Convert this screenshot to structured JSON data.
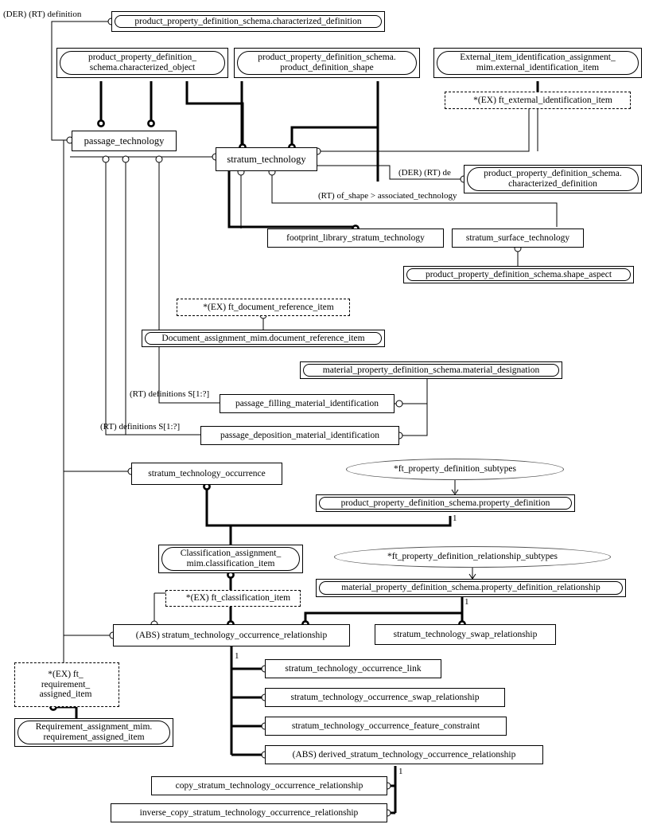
{
  "diagram": {
    "title": "EXPRESS-G entity level diagram",
    "nodes": [
      {
        "id": "n1",
        "label": "product_property_definition_schema.characterized_definition",
        "kind": "capsule"
      },
      {
        "id": "n2",
        "label": "product_property_definition_\nschema.characterized_object",
        "kind": "capsule"
      },
      {
        "id": "n3",
        "label": "product_property_definition_schema.\nproduct_definition_shape",
        "kind": "capsule"
      },
      {
        "id": "n4",
        "label": "External_item_identification_assignment_\nmim.external_identification_item",
        "kind": "capsule"
      },
      {
        "id": "n5",
        "label": "*(EX) ft_external_identification_item",
        "kind": "dashed"
      },
      {
        "id": "n6",
        "label": "passage_technology",
        "kind": "plain"
      },
      {
        "id": "n7",
        "label": "stratum_technology",
        "kind": "plain"
      },
      {
        "id": "n8",
        "label": "product_property_definition_schema.\ncharacterized_definition",
        "kind": "capsule"
      },
      {
        "id": "n9",
        "label": "footprint_library_stratum_technology",
        "kind": "plain"
      },
      {
        "id": "n10",
        "label": "stratum_surface_technology",
        "kind": "plain"
      },
      {
        "id": "n11",
        "label": "product_property_definition_schema.shape_aspect",
        "kind": "capsule"
      },
      {
        "id": "n12",
        "label": "*(EX) ft_document_reference_item",
        "kind": "dashed"
      },
      {
        "id": "n13",
        "label": "Document_assignment_mim.document_reference_item",
        "kind": "capsule"
      },
      {
        "id": "n14",
        "label": "material_property_definition_schema.material_designation",
        "kind": "capsule"
      },
      {
        "id": "n15",
        "label": "passage_filling_material_identification",
        "kind": "plain"
      },
      {
        "id": "n16",
        "label": "passage_deposition_material_identification",
        "kind": "plain"
      },
      {
        "id": "n17",
        "label": "stratum_technology_occurrence",
        "kind": "plain"
      },
      {
        "id": "n18",
        "label": "*ft_property_definition_subtypes",
        "kind": "ellipse"
      },
      {
        "id": "n19",
        "label": "product_property_definition_schema.property_definition",
        "kind": "capsule"
      },
      {
        "id": "n20",
        "label": "Classification_assignment_\nmim.classification_item",
        "kind": "capsule"
      },
      {
        "id": "n21",
        "label": "*ft_property_definition_relationship_subtypes",
        "kind": "ellipse"
      },
      {
        "id": "n22",
        "label": "material_property_definition_schema.property_definition_relationship",
        "kind": "capsule"
      },
      {
        "id": "n23",
        "label": "*(EX) ft_classification_item",
        "kind": "dashed"
      },
      {
        "id": "n24",
        "label": "(ABS) stratum_technology_occurrence_relationship",
        "kind": "plain"
      },
      {
        "id": "n25",
        "label": "stratum_technology_swap_relationship",
        "kind": "plain"
      },
      {
        "id": "n26",
        "label": "*(EX) ft_\nrequirement_\nassigned_item",
        "kind": "dashed-center"
      },
      {
        "id": "n27",
        "label": "Requirement_assignment_mim.\nrequirement_assigned_item",
        "kind": "capsule"
      },
      {
        "id": "n28",
        "label": "stratum_technology_occurrence_link",
        "kind": "plain"
      },
      {
        "id": "n29",
        "label": "stratum_technology_occurrence_swap_relationship",
        "kind": "plain"
      },
      {
        "id": "n30",
        "label": "stratum_technology_occurrence_feature_constraint",
        "kind": "plain"
      },
      {
        "id": "n31",
        "label": "(ABS) derived_stratum_technology_occurrence_relationship",
        "kind": "plain"
      },
      {
        "id": "n32",
        "label": "copy_stratum_technology_occurrence_relationship",
        "kind": "plain"
      },
      {
        "id": "n33",
        "label": "inverse_copy_stratum_technology_occurrence_relationship",
        "kind": "plain"
      }
    ],
    "edge_labels": [
      {
        "id": "e1",
        "text": "(DER) (RT) definition"
      },
      {
        "id": "e2",
        "text": "(DER) (RT) de"
      },
      {
        "id": "e3",
        "text": "(RT) of_shape > associated_technology"
      },
      {
        "id": "e4",
        "text": "(RT) definitions S[1:?]"
      },
      {
        "id": "e5",
        "text": "(RT) definitions S[1:?]"
      }
    ],
    "cardinalities": [
      {
        "id": "c1",
        "text": "1"
      },
      {
        "id": "c2",
        "text": "1"
      },
      {
        "id": "c3",
        "text": "1"
      },
      {
        "id": "c4",
        "text": "1"
      }
    ],
    "colors": {
      "line": "#000000",
      "background": "#ffffff",
      "ellipse_stroke": "#555555"
    }
  }
}
